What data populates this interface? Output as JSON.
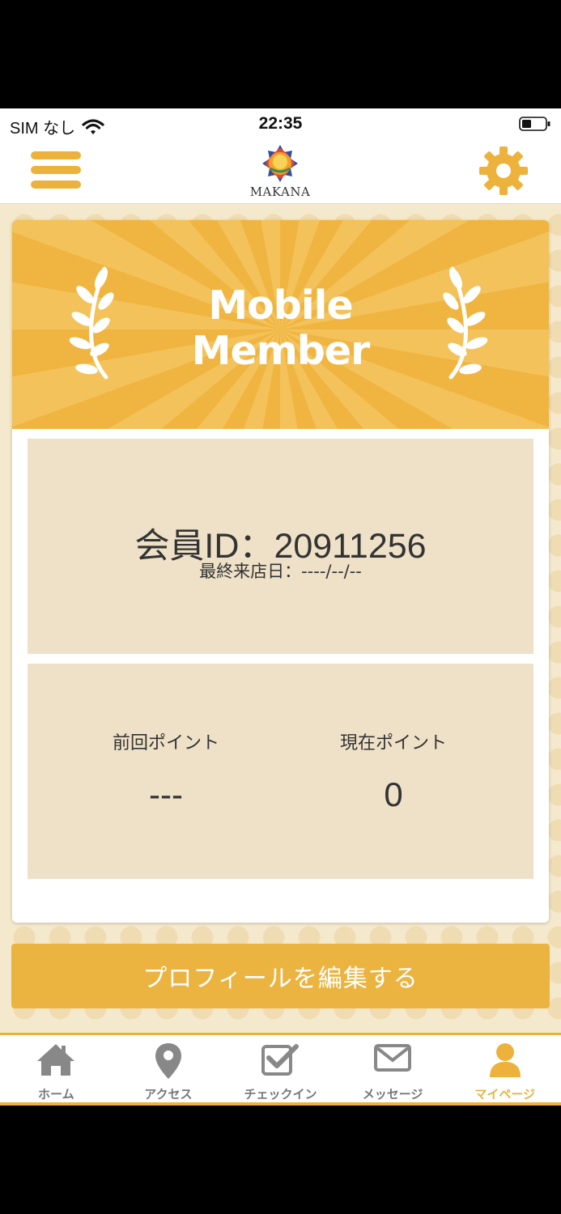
{
  "status_bar": {
    "carrier": "SIM なし",
    "time": "22:35"
  },
  "header": {
    "logo_text": "MAKANA"
  },
  "banner": {
    "title_line1": "Mobile",
    "title_line2": "Member"
  },
  "member": {
    "id_label": "会員ID：",
    "id_value": "20911256",
    "last_visit": "最終来店日：----/--/--"
  },
  "points": {
    "previous_label": "前回ポイント",
    "previous_value": "---",
    "current_label": "現在ポイント",
    "current_value": "0"
  },
  "edit_button": "プロフィールを編集する",
  "tabs": [
    {
      "label": "ホーム",
      "icon": "home-icon"
    },
    {
      "label": "アクセス",
      "icon": "map-pin-icon"
    },
    {
      "label": "チェックイン",
      "icon": "checkin-icon"
    },
    {
      "label": "メッセージ",
      "icon": "mail-icon"
    },
    {
      "label": "マイページ",
      "icon": "user-icon",
      "active": true
    }
  ],
  "colors": {
    "accent": "#ecb23c",
    "panel": "#eee1c7",
    "inactive_tab": "#777777"
  }
}
